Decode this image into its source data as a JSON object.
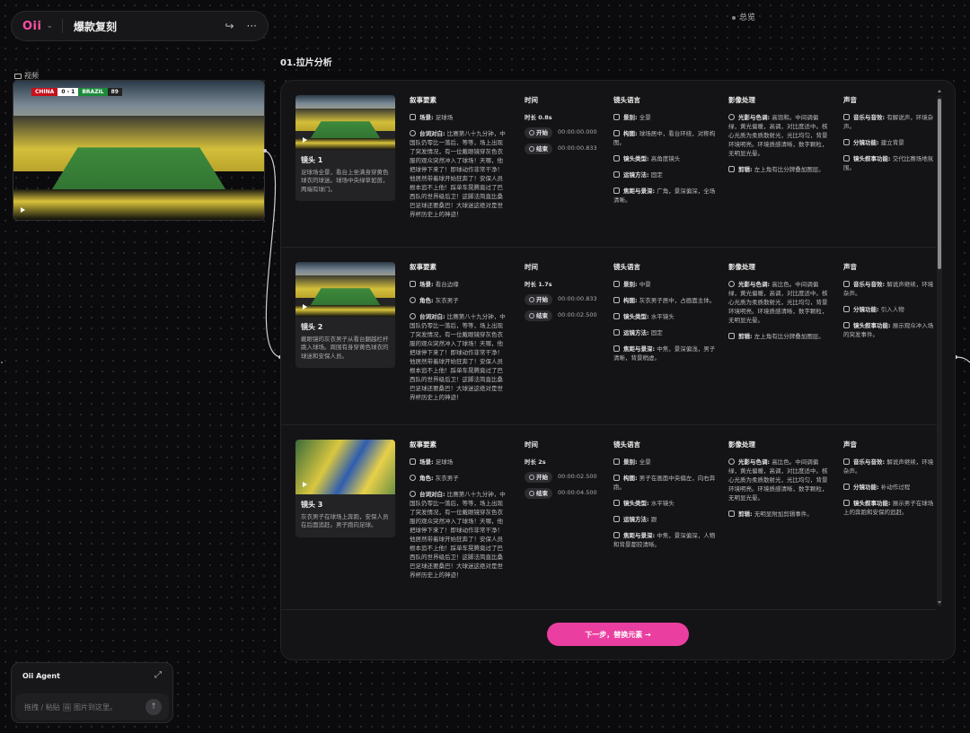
{
  "app": {
    "logo": "Oii",
    "title": "爆款复刻"
  },
  "overview": {
    "label": "总览"
  },
  "video": {
    "label": "视频",
    "scoreboard": {
      "team_a": "CHINA",
      "score": "0 - 1",
      "team_b": "BRAZIL",
      "time": "89"
    }
  },
  "section": {
    "title": "01.拉片分析"
  },
  "columns": {
    "narrative": "叙事要素",
    "time": "时间",
    "lens": "镜头语言",
    "image": "影像处理",
    "sound": "声音"
  },
  "field_labels": {
    "scene": "场景:",
    "role": "角色:",
    "lines": "台词对白:",
    "duration_prefix": "时长",
    "start": "开始",
    "end": "结束",
    "shot_size": "景别:",
    "composition": "构图:",
    "lens_type": "镜头类型:",
    "movement": "运镜方法:",
    "focus": "焦距与景深:",
    "light_color": "光影与色调:",
    "edit": "剪辑:",
    "music": "音乐与音效:",
    "shot_function": "分镜功能:",
    "narrative_function": "镜头叙事功能:"
  },
  "shots": [
    {
      "name": "镜头 1",
      "desc": "足球场全景，看台上坐满身穿黄色球衣的球迷。球场中央绿草如茵，两端有球门。",
      "scene": "足球场",
      "role": "",
      "lines": "比赛第八十九分钟，中国队仍零比一落后，等等，场上出现了突发情况，有一位戴眼镜穿灰色衣服的观众突然冲入了球场！天哪，他把球停下来了！即球动作非常干净！他居然带着球开始狂奔了！安保人员根本追不上他！踩单车晃腾竟过了巴西队的世界级后卫！这脚法简直比桑巴足球还要桑巴！大球迷这绝对是世界杯历史上的神迹！",
      "duration": "0.8s",
      "start": "00:00:00.000",
      "end": "00:00:00.833",
      "shot_size": "全景",
      "composition": "球场居中，看台环绕，对称构图。",
      "lens_type": "高角度镜头",
      "movement": "固定",
      "focus": "广角，景深偏深，全场清晰。",
      "light_color": "高饱和。中间调偏绿，黄光偏暖，高调，对比度适中。核心光质为柔质散射光，光比均匀，背景环境明亮。环境质感清晰，数字颗粒，无明显光晕。",
      "edit": "左上角有比分牌叠加图层。",
      "music": "有解说声，环境杂声。",
      "shot_function": "建立背景",
      "narrative_function": "交代比赛场地氛围。"
    },
    {
      "name": "镜头 2",
      "desc": "戴眼镜的灰衣男子从看台翻越栏杆跳入球场。周围有身穿黄色球衣的球迷和安保人员。",
      "scene": "看台边缘",
      "role": "灰衣男子",
      "lines": "比赛第八十九分钟，中国队仍零比一落后，等等，场上出现了突发情况，有一位戴眼镜穿灰色衣服的观众突然冲入了球场！天哪，他把球停下来了！即球动作非常干净！他居然带着球开始狂奔了！安保人员根本追不上他！踩单车晃腾竟过了巴西队的世界级后卫！这脚法简直比桑巴足球还要桑巴！大球迷这绝对是世界杯历史上的神迹！",
      "duration": "1.7s",
      "start": "00:00:00.833",
      "end": "00:00:02.500",
      "shot_size": "中景",
      "composition": "灰衣男子居中，占画面主体。",
      "lens_type": "水平镜头",
      "movement": "固定",
      "focus": "中焦，景深偏浅，男子清晰，背景稍虚。",
      "light_color": "高比色。中间调偏绿，黄光偏暖，高调，对比度适中。核心光质为柔质散射光，光比均匀，背景环境明亮。环境质感清晰，数字颗粒，无明显光晕。",
      "edit": "左上角有比分牌叠加图层。",
      "music": "解说声继续，环境杂声。",
      "shot_function": "引入人物",
      "narrative_function": "展示观众冲入场的突发事件。"
    },
    {
      "name": "镜头 3",
      "desc": "灰衣男子在球场上奔跑，安保人员在后面追赶。男子跑向足球。",
      "scene": "足球场",
      "role": "灰衣男子",
      "lines": "比赛第八十九分钟，中国队仍零比一落后，等等，场上出现了突发情况，有一位戴眼镜穿灰色衣服的观众突然冲入了球场！天哪，他把球停下来了！即球动作非常干净！他居然带着球开始狂奔了！安保人员根本追不上他！踩单车晃腾竟过了巴西队的世界级后卫！这脚法简直比桑巴足球还要桑巴！大球迷这绝对是世界杯历史上的神迹！",
      "duration": "2s",
      "start": "00:00:02.500",
      "end": "00:00:04.500",
      "shot_size": "全景",
      "composition": "男子在画面中央偏左，向右奔跑。",
      "lens_type": "水平镜头",
      "movement": "跟",
      "focus": "中焦，景深偏深，人物和背景都较清晰。",
      "light_color": "高比色。中间调偏绿，黄光偏暖，高调，对比度适中。核心光质为柔质散射光，光比均匀，背景环境明亮。环境质感清晰，数字颗粒，无明显光晕。",
      "edit": "无明显附加剪辑事件。",
      "music": "解说声继续，环境杂声。",
      "shot_function": "补动作过程",
      "narrative_function": "展示男子在球场上的奔跑和安保的追赶。"
    }
  ],
  "next_button": {
    "label": "下一步，替换元素 →"
  },
  "agent": {
    "title": "Oii Agent",
    "placeholder": "拖拽 / 粘贴 🖼 图片到这里。"
  }
}
